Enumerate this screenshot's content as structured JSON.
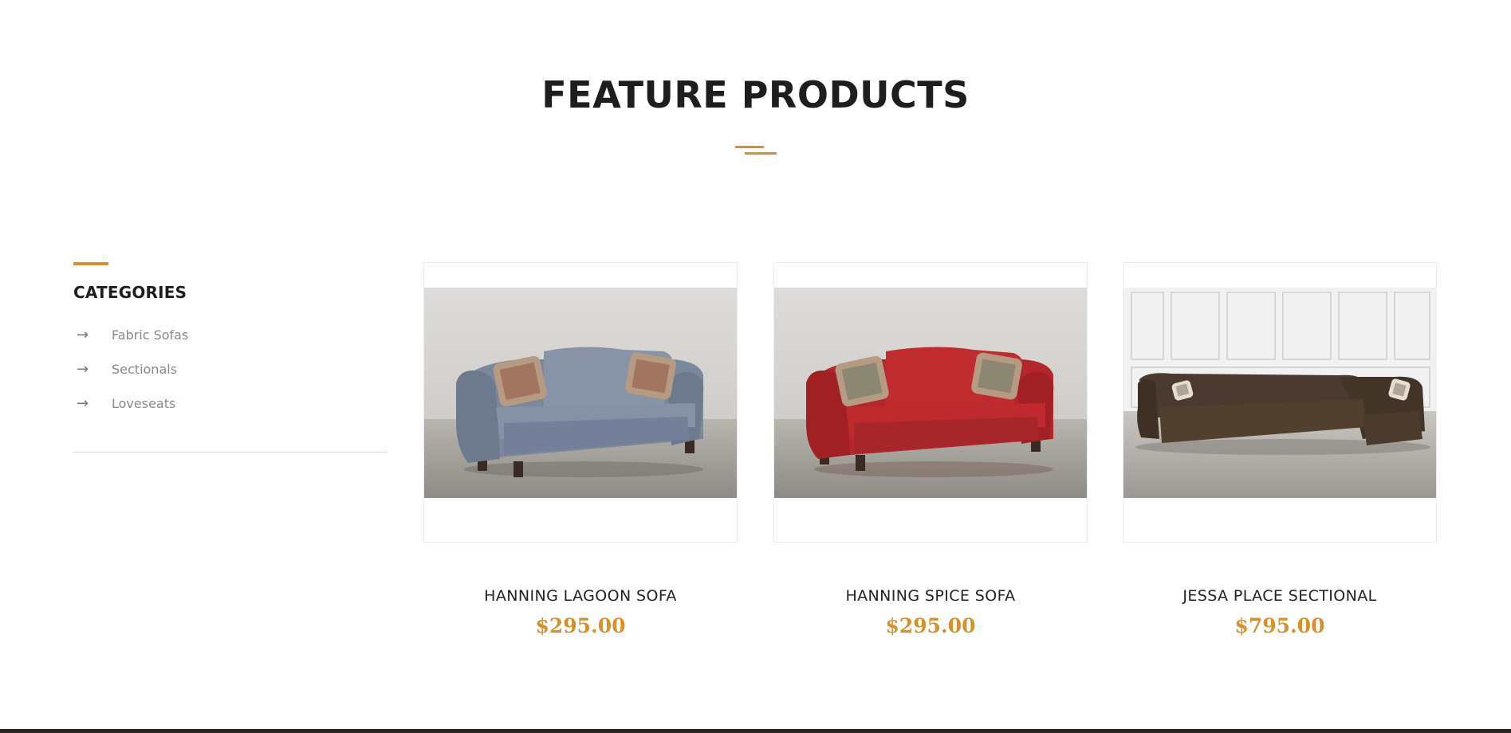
{
  "section": {
    "title": "FEATURE PRODUCTS"
  },
  "categories": {
    "heading": "CATEGORIES",
    "items": [
      {
        "icon": "arrow-right-icon",
        "label": "Fabric Sofas"
      },
      {
        "icon": "arrow-right-icon",
        "label": "Sectionals"
      },
      {
        "icon": "arrow-right-icon",
        "label": "Loveseats"
      }
    ]
  },
  "products": [
    {
      "name": "HANNING LAGOON SOFA",
      "price": "$295.00",
      "image": "gray-blue sofa with patterned pillows"
    },
    {
      "name": "HANNING SPICE SOFA",
      "price": "$295.00",
      "image": "red sofa with patterned pillows"
    },
    {
      "name": "JESSA PLACE SECTIONAL",
      "price": "$795.00",
      "image": "dark brown sectional sofa"
    }
  ],
  "colors": {
    "accent": "#d4922e",
    "heading": "#1e1e1e",
    "muted_text": "#8a8a8a",
    "border": "#ececec"
  }
}
